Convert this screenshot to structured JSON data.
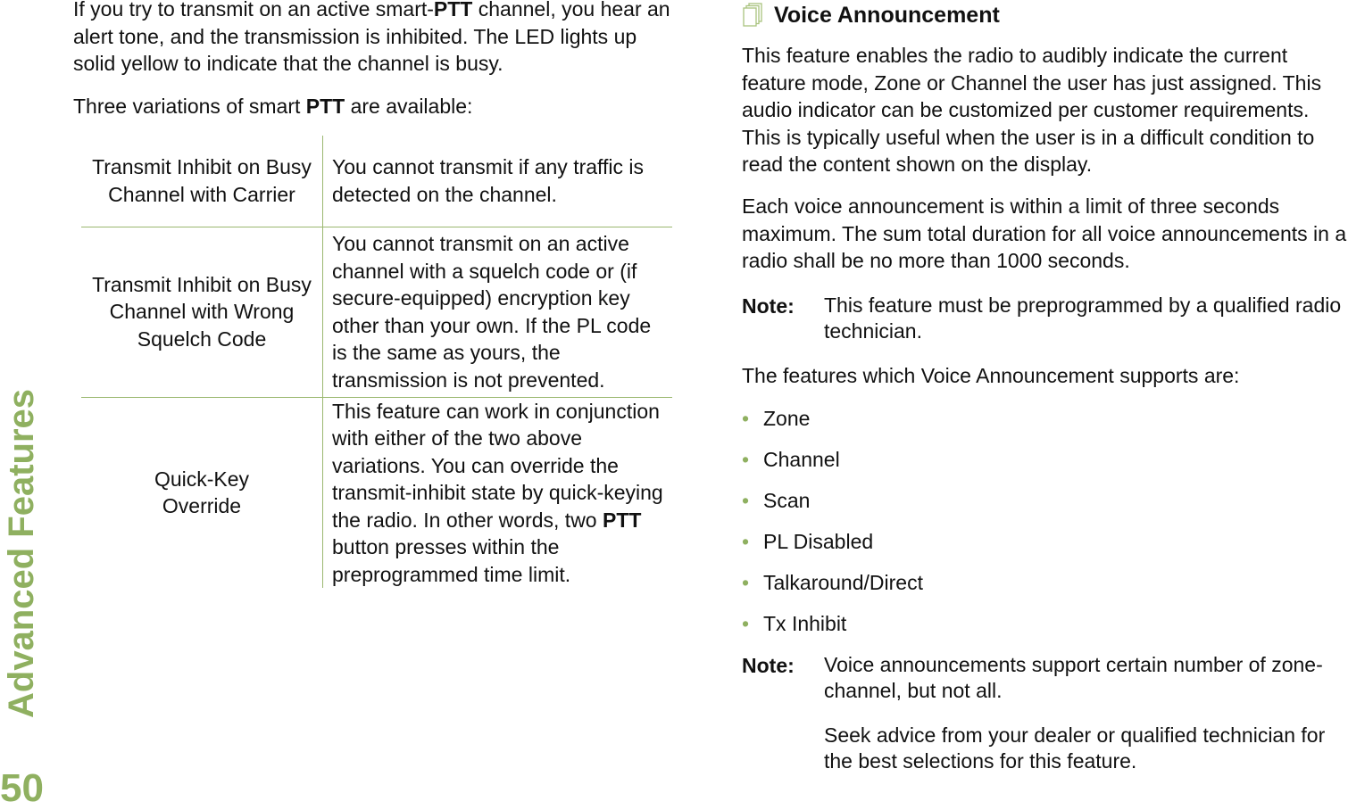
{
  "sidebar": {
    "section": "Advanced Features",
    "page_number": "50"
  },
  "left": {
    "intro": [
      "If you try to transmit on an active smart-",
      "PTT",
      " channel, you hear an alert tone, and the transmission is inhibited. The LED lights up solid yellow to indicate that the channel is busy."
    ],
    "variations": [
      "Three variations of smart ",
      "PTT",
      " are available:"
    ],
    "table": [
      {
        "name": "Transmit Inhibit on Busy Channel with Carrier",
        "desc": [
          "You cannot transmit if any traffic is detected on the channel.",
          "",
          ""
        ]
      },
      {
        "name": "Transmit Inhibit on Busy Channel with Wrong Squelch Code",
        "desc": [
          "You cannot transmit on an active channel with a squelch code or (if secure-equipped) encryption key other than your own. If the PL code is the same as yours, the transmission is not prevented.",
          "",
          ""
        ]
      },
      {
        "name": "Quick-Key Override",
        "desc": [
          "This feature can work in conjunction with either of the two above variations. You can override the transmit-inhibit state by quick-keying the radio. In other words, two ",
          "PTT",
          " button presses within the preprogrammed time limit."
        ]
      }
    ]
  },
  "right": {
    "heading": "Voice Announcement",
    "heading_icon": "pages-icon",
    "p1": "This feature enables the radio to audibly indicate the current feature mode, Zone or Channel the user has just assigned. This audio indicator can be customized per customer requirements. This is typically useful when the user is in a difficult condition to read the content shown on the display.",
    "p2": "Each voice announcement is within a limit of three seconds maximum. The sum total duration for all voice announcements in a radio shall be no more than 1000 seconds.",
    "note1": {
      "label": "Note:",
      "text": "This feature must be preprogrammed by a qualified radio technician."
    },
    "p3": "The features which Voice Announcement supports are:",
    "bullets": [
      "Zone",
      "Channel",
      "Scan",
      "PL Disabled",
      "Talkaround/Direct",
      "Tx Inhibit"
    ],
    "note2": {
      "label": "Note:",
      "text": "Voice announcements support certain number of zone-channel, but not all.",
      "text2": "Seek advice from your dealer or qualified technician for the best selections for this feature."
    }
  },
  "colors": {
    "accent": "#8fb060"
  }
}
